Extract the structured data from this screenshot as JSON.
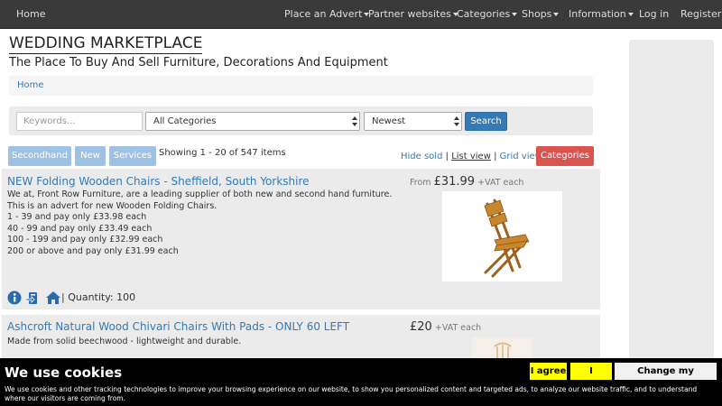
{
  "nav": {
    "home": "Home",
    "items": [
      {
        "label": "Place an Advert",
        "dropdown": true
      },
      {
        "label": "Partner websites",
        "dropdown": true
      },
      {
        "label": "Categories",
        "dropdown": true
      },
      {
        "label": "Shops",
        "dropdown": true
      },
      {
        "label": "Information",
        "dropdown": true
      },
      {
        "label": "Log in",
        "dropdown": false
      },
      {
        "label": "Register",
        "dropdown": false
      }
    ]
  },
  "header": {
    "title": "WEDDING MARKETPLACE",
    "tagline": "The Place To Buy And Sell Furniture, Decorations And Equipment"
  },
  "breadcrumb": {
    "home": "Home"
  },
  "search": {
    "placeholder": "Keywords...",
    "category": "All Categories",
    "sort": "Newest",
    "button": "Search"
  },
  "filters": {
    "secondhand": "Secondhand",
    "new": "New",
    "services": "Services",
    "showing": "Showing 1 - 20 of 547 items",
    "hide_sold": "Hide sold",
    "list_view": "List view",
    "grid_view": "Grid view",
    "sep": "|",
    "categories_button": "Categories"
  },
  "listings": [
    {
      "title": "NEW Folding Wooden Chairs - Sheffield, South Yorkshire",
      "price_prefix": "From",
      "price": "£31.99",
      "price_suffix": "+VAT each",
      "description": [
        "We at, Front Row Furniture, are a leading supplier of both new and second hand furniture.",
        "This is an advert for new Wooden Folding Chairs.",
        "1 - 39 and pay only £33.98 each",
        "40 - 99 and pay only £33.49 each",
        "100 - 199 and pay only £32.99 each",
        "200 or above and pay only £31.99 each"
      ],
      "quantity": "| Quantity: 100",
      "icons": [
        "info-icon",
        "seller-icon",
        "home-icon"
      ]
    },
    {
      "title": "Ashcroft Natural Wood Chivari Chairs With Pads - ONLY 60 LEFT",
      "price_prefix": "",
      "price": "£20",
      "price_suffix": "+VAT each",
      "description": [
        "Made from solid beechwood - lightweight and durable."
      ]
    }
  ],
  "cookie": {
    "title": "We use cookies",
    "text": "We use cookies and other tracking technologies to improve your browsing experience on our website, to show you personalized content and targeted ads, to analyze our website traffic, and to understand where our visitors are coming from.",
    "agree": "I agree",
    "decline": "I decline",
    "prefs": "Change my preferences"
  },
  "colors": {
    "navbar": "#3a3a3a",
    "link": "#337ab7",
    "pill": "#9fc1e3",
    "danger": "#d9534f",
    "cookie_button": "#ffff00"
  }
}
